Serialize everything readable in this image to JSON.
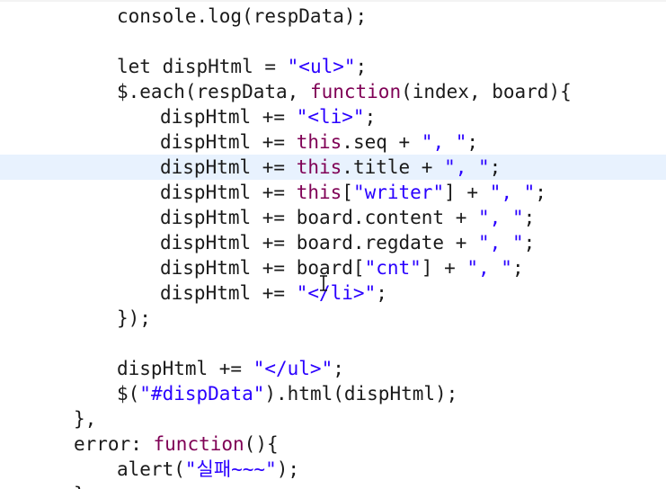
{
  "editor": {
    "lines": [
      {
        "indent": 2,
        "current": false,
        "tokens": [
          {
            "t": "console.log(respData);"
          }
        ]
      },
      {
        "indent": 0,
        "current": false,
        "tokens": []
      },
      {
        "indent": 2,
        "current": false,
        "tokens": [
          {
            "t": "let dispHtml = "
          },
          {
            "t": "\"<ul>\"",
            "c": "str"
          },
          {
            "t": ";"
          }
        ]
      },
      {
        "indent": 2,
        "current": false,
        "tokens": [
          {
            "t": "$.each(respData, "
          },
          {
            "t": "function",
            "c": "kw"
          },
          {
            "t": "(index, board){"
          }
        ]
      },
      {
        "indent": 3,
        "current": false,
        "tokens": [
          {
            "t": "dispHtml += "
          },
          {
            "t": "\"<li>\"",
            "c": "str"
          },
          {
            "t": ";"
          }
        ]
      },
      {
        "indent": 3,
        "current": false,
        "tokens": [
          {
            "t": "dispHtml += "
          },
          {
            "t": "this",
            "c": "kw"
          },
          {
            "t": ".seq + "
          },
          {
            "t": "\", \"",
            "c": "str"
          },
          {
            "t": ";"
          }
        ]
      },
      {
        "indent": 3,
        "current": true,
        "tokens": [
          {
            "t": "dispHtml += "
          },
          {
            "t": "this",
            "c": "kw"
          },
          {
            "t": ".title + "
          },
          {
            "t": "\", \"",
            "c": "str"
          },
          {
            "t": ";"
          }
        ]
      },
      {
        "indent": 3,
        "current": false,
        "tokens": [
          {
            "t": "dispHtml += "
          },
          {
            "t": "this",
            "c": "kw"
          },
          {
            "t": "["
          },
          {
            "t": "\"writer\"",
            "c": "str"
          },
          {
            "t": "] + "
          },
          {
            "t": "\", \"",
            "c": "str"
          },
          {
            "t": ";"
          }
        ]
      },
      {
        "indent": 3,
        "current": false,
        "tokens": [
          {
            "t": "dispHtml += board.content + "
          },
          {
            "t": "\", \"",
            "c": "str"
          },
          {
            "t": ";"
          }
        ]
      },
      {
        "indent": 3,
        "current": false,
        "tokens": [
          {
            "t": "dispHtml += board.regdate + "
          },
          {
            "t": "\", \"",
            "c": "str"
          },
          {
            "t": ";"
          }
        ]
      },
      {
        "indent": 3,
        "current": false,
        "tokens": [
          {
            "t": "dispHtml += board["
          },
          {
            "t": "\"cnt\"",
            "c": "str"
          },
          {
            "t": "] + "
          },
          {
            "t": "\", \"",
            "c": "str"
          },
          {
            "t": ";"
          }
        ]
      },
      {
        "indent": 3,
        "current": false,
        "tokens": [
          {
            "t": "dispHtml += "
          },
          {
            "t": "\"</li>\"",
            "c": "str"
          },
          {
            "t": ";"
          }
        ]
      },
      {
        "indent": 2,
        "current": false,
        "tokens": [
          {
            "t": "});"
          }
        ]
      },
      {
        "indent": 0,
        "current": false,
        "tokens": []
      },
      {
        "indent": 2,
        "current": false,
        "tokens": [
          {
            "t": "dispHtml += "
          },
          {
            "t": "\"</ul>\"",
            "c": "str"
          },
          {
            "t": ";"
          }
        ]
      },
      {
        "indent": 2,
        "current": false,
        "tokens": [
          {
            "t": "$("
          },
          {
            "t": "\"#dispData\"",
            "c": "str"
          },
          {
            "t": ").html(dispHtml);"
          }
        ]
      },
      {
        "indent": 1,
        "current": false,
        "tokens": [
          {
            "t": "},"
          }
        ]
      },
      {
        "indent": 1,
        "current": false,
        "tokens": [
          {
            "t": "error: "
          },
          {
            "t": "function",
            "c": "kw"
          },
          {
            "t": "(){"
          }
        ]
      },
      {
        "indent": 2,
        "current": false,
        "tokens": [
          {
            "t": "alert("
          },
          {
            "t": "\"실패~~~\"",
            "c": "str"
          },
          {
            "t": ");"
          }
        ]
      },
      {
        "indent": 1,
        "current": false,
        "tokens": [
          {
            "t": "}"
          }
        ]
      }
    ]
  }
}
